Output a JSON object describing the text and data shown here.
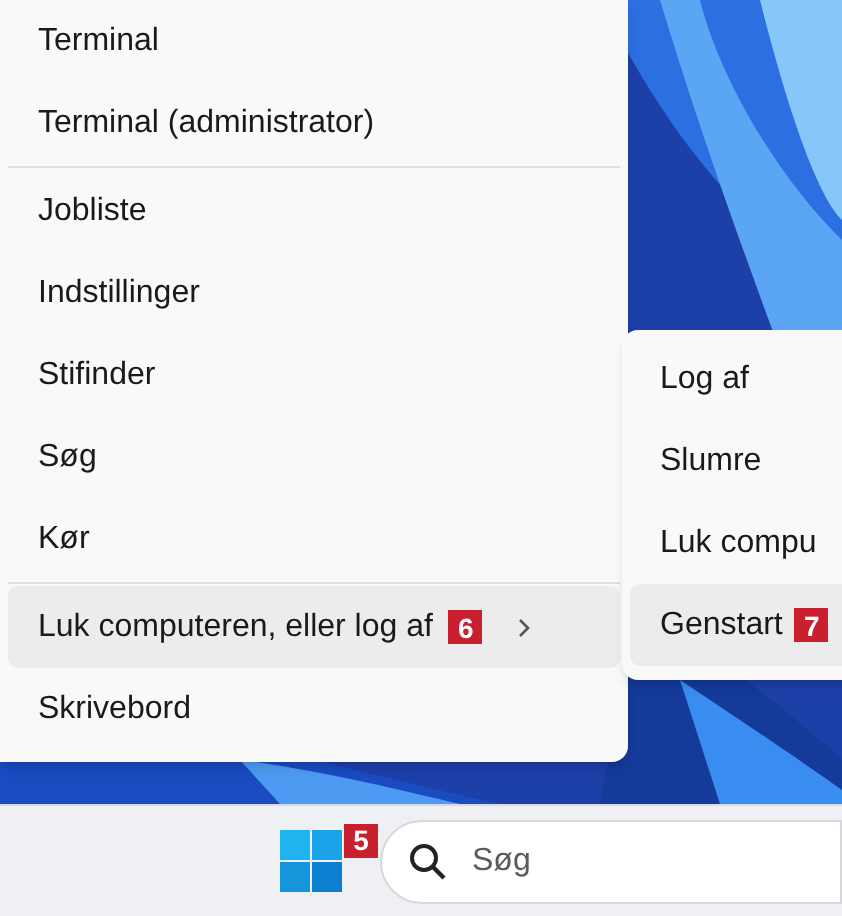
{
  "context_menu": {
    "groups": [
      {
        "items": [
          {
            "label": "Terminal",
            "selected": false
          },
          {
            "label": "Terminal (administrator)",
            "selected": false
          }
        ]
      },
      {
        "items": [
          {
            "label": "Jobliste",
            "selected": false
          },
          {
            "label": "Indstillinger",
            "selected": false
          },
          {
            "label": "Stifinder",
            "selected": false
          },
          {
            "label": "Søg",
            "selected": false
          },
          {
            "label": "Kør",
            "selected": false
          }
        ]
      },
      {
        "items": [
          {
            "label": "Luk computeren, eller log af",
            "selected": true,
            "badge": "6",
            "submenu": true
          },
          {
            "label": "Skrivebord",
            "selected": false
          }
        ]
      }
    ]
  },
  "submenu": {
    "items": [
      {
        "label": "Log af",
        "selected": false
      },
      {
        "label": "Slumre",
        "selected": false
      },
      {
        "label": "Luk compu",
        "selected": false
      },
      {
        "label": "Genstart",
        "selected": true,
        "badge": "7"
      }
    ]
  },
  "taskbar": {
    "start_badge": "5",
    "search": {
      "placeholder": "Søg"
    }
  }
}
